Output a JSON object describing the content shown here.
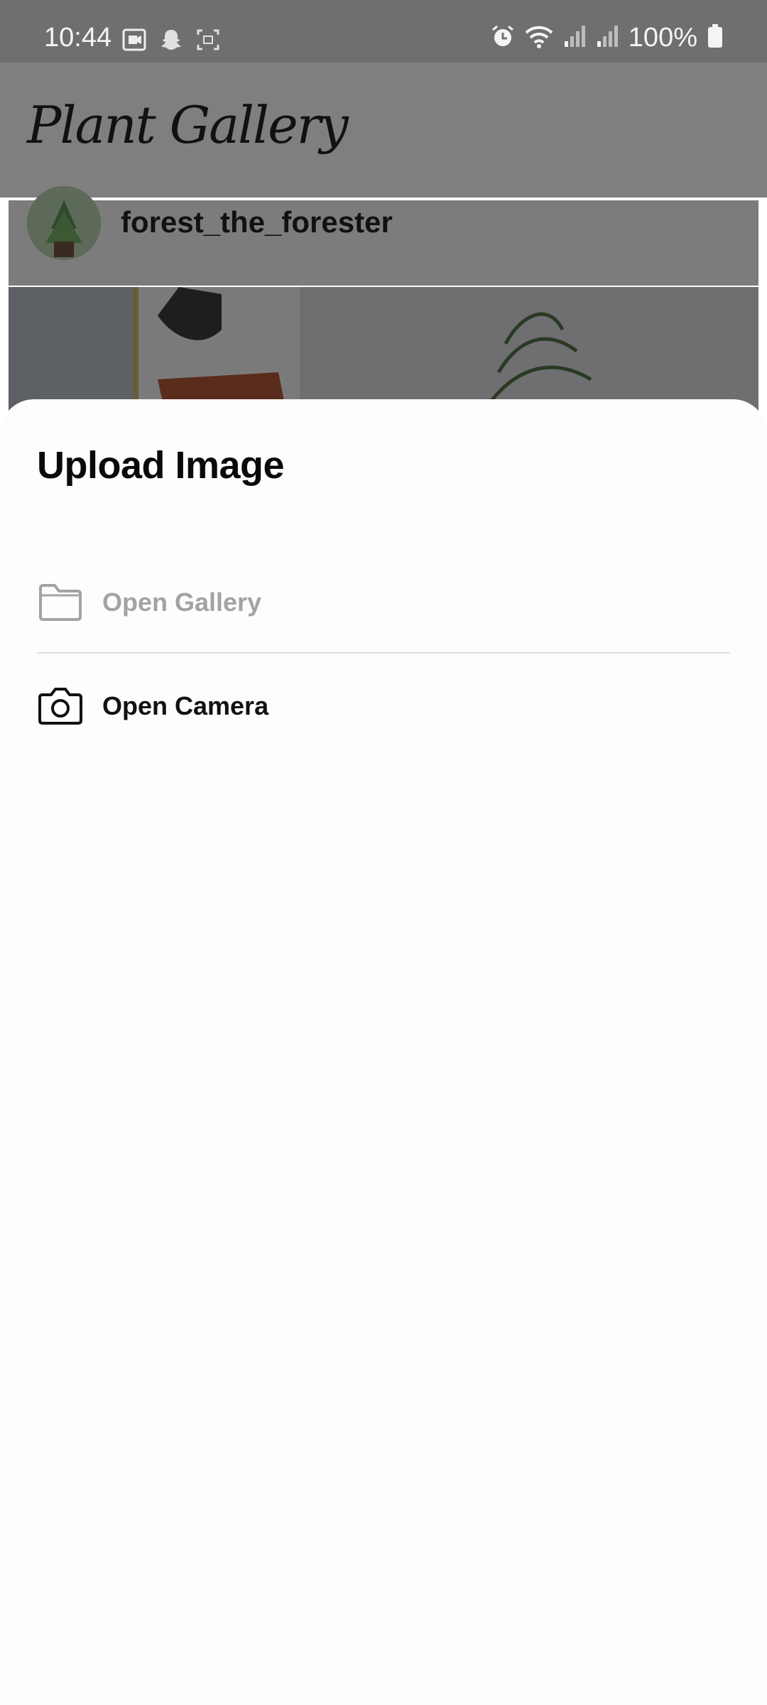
{
  "status_bar": {
    "time": "10:44",
    "battery": "100%",
    "left_icons": [
      "screen-recorder-icon",
      "snapchat-icon",
      "screenshot-icon"
    ],
    "right_icons": [
      "alarm-icon",
      "wifi-icon",
      "signal-icon",
      "signal-icon",
      "battery-icon"
    ]
  },
  "app": {
    "title": "Plant Gallery"
  },
  "post": {
    "username": "forest_the_forester"
  },
  "sheet": {
    "title": "Upload Image",
    "options": [
      {
        "label": "Open Gallery",
        "icon": "folder-icon",
        "enabled": false
      },
      {
        "label": "Open Camera",
        "icon": "camera-icon",
        "enabled": true
      }
    ]
  },
  "colors": {
    "scrim": "#7f7f7f",
    "sheet_bg": "#fdfdfd",
    "disabled_text": "#a3a3a3",
    "primary_text": "#111111"
  }
}
